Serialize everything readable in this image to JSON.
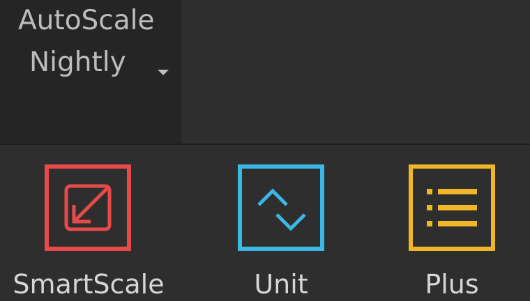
{
  "plugin_tab": {
    "title_line1": "AutoScale",
    "title_line2": "Nightly",
    "dropdown_icon": "caret-down-icon"
  },
  "tools": [
    {
      "label": "SmartScale",
      "icon": "scale-arrow-icon",
      "color": "#e84a4a"
    },
    {
      "label": "Unit",
      "icon": "chevrons-up-down-icon",
      "color": "#3cb8e6"
    },
    {
      "label": "Plus",
      "icon": "list-icon",
      "color": "#f0b627"
    }
  ],
  "colors": {
    "background": "#2e2e2e",
    "tab_background": "#252525",
    "text": "#d6d6d6"
  }
}
